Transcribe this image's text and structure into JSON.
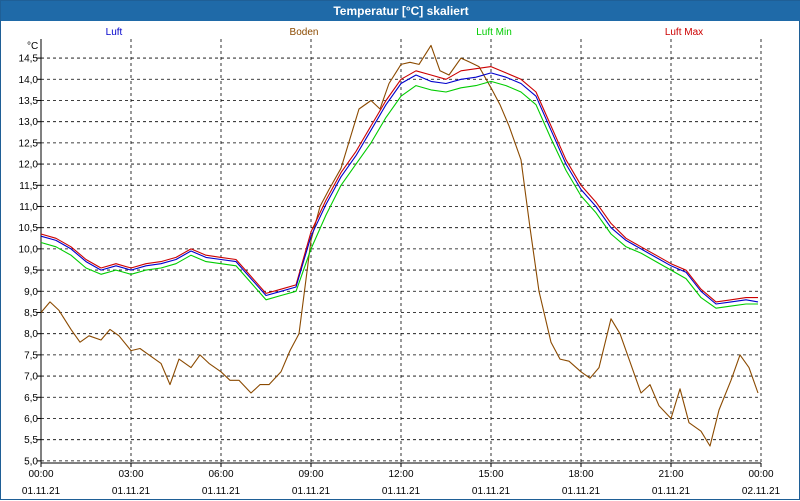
{
  "chart_data": {
    "type": "line",
    "title": "Temperatur [°C] skaliert",
    "ylabel": "°C",
    "xlabel": "",
    "ylim": [
      4.95,
      14.95
    ],
    "xlim": [
      0,
      24
    ],
    "grid": true,
    "legend_position": "top",
    "y_ticks": [
      "5,0",
      "5,5",
      "6,0",
      "6,5",
      "7,0",
      "7,5",
      "8,0",
      "8,5",
      "9,0",
      "9,5",
      "10,0",
      "10,5",
      "11,0",
      "11,5",
      "12,0",
      "12,5",
      "13,0",
      "13,5",
      "14,0",
      "14,5"
    ],
    "x_ticks": [
      {
        "time": "00:00",
        "date": "01.11.21"
      },
      {
        "time": "03:00",
        "date": "01.11.21"
      },
      {
        "time": "06:00",
        "date": "01.11.21"
      },
      {
        "time": "09:00",
        "date": "01.11.21"
      },
      {
        "time": "12:00",
        "date": "01.11.21"
      },
      {
        "time": "15:00",
        "date": "01.11.21"
      },
      {
        "time": "18:00",
        "date": "01.11.21"
      },
      {
        "time": "21:00",
        "date": "01.11.21"
      },
      {
        "time": "00:00",
        "date": "02.11.21"
      }
    ],
    "x_unit": "hours since 01.11.21 00:00",
    "series": [
      {
        "name": "Luft",
        "color": "#0000cc",
        "x": [
          0,
          0.5,
          1,
          1.5,
          2,
          2.5,
          3,
          3.5,
          4,
          4.5,
          5,
          5.5,
          6,
          6.5,
          7,
          7.5,
          8,
          8.5,
          9,
          9.5,
          10,
          10.5,
          11,
          11.5,
          12,
          12.5,
          13,
          13.5,
          14,
          14.5,
          15,
          15.5,
          16,
          16.5,
          17,
          17.5,
          18,
          18.5,
          19,
          19.5,
          20,
          20.5,
          21,
          21.5,
          22,
          22.5,
          23,
          23.5,
          23.9
        ],
        "values": [
          10.3,
          10.2,
          10,
          9.7,
          9.5,
          9.6,
          9.5,
          9.6,
          9.65,
          9.75,
          9.95,
          9.8,
          9.75,
          9.7,
          9.3,
          8.9,
          9,
          9.1,
          10.3,
          11.05,
          11.7,
          12.2,
          12.8,
          13.4,
          13.9,
          14.1,
          13.95,
          13.9,
          14.0,
          14.05,
          14.15,
          14.05,
          13.9,
          13.6,
          12.8,
          12.0,
          11.4,
          11.0,
          10.5,
          10.2,
          10.0,
          9.8,
          9.6,
          9.45,
          9.0,
          8.7,
          8.75,
          8.8,
          8.75
        ]
      },
      {
        "name": "Boden",
        "color": "#8b4a00",
        "x": [
          0,
          0.3,
          0.6,
          1,
          1.3,
          1.6,
          2,
          2.3,
          2.6,
          3,
          3.3,
          3.6,
          4,
          4.3,
          4.6,
          5,
          5.3,
          5.6,
          6,
          6.3,
          6.6,
          7,
          7.3,
          7.6,
          8,
          8.3,
          8.6,
          9,
          9.3,
          9.6,
          10,
          10.3,
          10.6,
          11,
          11.3,
          11.6,
          12,
          12.3,
          12.6,
          13,
          13.3,
          13.6,
          14,
          14.3,
          14.6,
          15,
          15.3,
          15.6,
          16,
          16.3,
          16.6,
          17,
          17.3,
          17.6,
          18,
          18.3,
          18.6,
          19,
          19.3,
          19.6,
          20,
          20.3,
          20.6,
          21,
          21.3,
          21.6,
          22,
          22.3,
          22.6,
          23,
          23.3,
          23.6,
          23.9
        ],
        "values": [
          8.5,
          8.75,
          8.55,
          8.1,
          7.8,
          7.95,
          7.85,
          8.1,
          7.95,
          7.6,
          7.65,
          7.5,
          7.3,
          6.8,
          7.4,
          7.2,
          7.5,
          7.3,
          7.1,
          6.9,
          6.9,
          6.6,
          6.8,
          6.8,
          7.1,
          7.6,
          8.0,
          10.2,
          11.0,
          11.4,
          11.9,
          12.6,
          13.3,
          13.5,
          13.3,
          13.9,
          14.35,
          14.4,
          14.35,
          14.8,
          14.2,
          14.1,
          14.5,
          14.4,
          14.3,
          13.8,
          13.4,
          12.9,
          12.1,
          10.5,
          9.0,
          7.8,
          7.4,
          7.35,
          7.1,
          6.95,
          7.2,
          8.35,
          8.0,
          7.4,
          6.6,
          6.8,
          6.3,
          6.0,
          6.7,
          5.9,
          5.7,
          5.35,
          6.2,
          6.9,
          7.5,
          7.2,
          6.6
        ]
      },
      {
        "name": "Luft Min",
        "color": "#00cc00",
        "x": [
          0,
          0.5,
          1,
          1.5,
          2,
          2.5,
          3,
          3.5,
          4,
          4.5,
          5,
          5.5,
          6,
          6.5,
          7,
          7.5,
          8,
          8.5,
          9,
          9.5,
          10,
          10.5,
          11,
          11.5,
          12,
          12.5,
          13,
          13.5,
          14,
          14.5,
          15,
          15.5,
          16,
          16.5,
          17,
          17.5,
          18,
          18.5,
          19,
          19.5,
          20,
          20.5,
          21,
          21.5,
          22,
          22.5,
          23,
          23.5,
          23.9
        ],
        "values": [
          10.15,
          10.05,
          9.85,
          9.55,
          9.4,
          9.5,
          9.4,
          9.5,
          9.55,
          9.65,
          9.85,
          9.7,
          9.65,
          9.6,
          9.2,
          8.8,
          8.9,
          9.0,
          10.0,
          10.8,
          11.5,
          12.0,
          12.5,
          13.1,
          13.6,
          13.85,
          13.75,
          13.7,
          13.8,
          13.85,
          13.95,
          13.85,
          13.7,
          13.4,
          12.6,
          11.85,
          11.25,
          10.85,
          10.35,
          10.05,
          9.9,
          9.7,
          9.5,
          9.3,
          8.85,
          8.6,
          8.65,
          8.7,
          8.7
        ]
      },
      {
        "name": "Luft Max",
        "color": "#cc0000",
        "x": [
          0,
          0.5,
          1,
          1.5,
          2,
          2.5,
          3,
          3.5,
          4,
          4.5,
          5,
          5.5,
          6,
          6.5,
          7,
          7.5,
          8,
          8.5,
          9,
          9.5,
          10,
          10.5,
          11,
          11.5,
          12,
          12.5,
          13,
          13.5,
          14,
          14.5,
          15,
          15.5,
          16,
          16.5,
          17,
          17.5,
          18,
          18.5,
          19,
          19.5,
          20,
          20.5,
          21,
          21.5,
          22,
          22.5,
          23,
          23.5,
          23.9
        ],
        "values": [
          10.35,
          10.25,
          10.05,
          9.75,
          9.55,
          9.65,
          9.55,
          9.65,
          9.7,
          9.8,
          10.0,
          9.85,
          9.8,
          9.75,
          9.35,
          8.95,
          9.05,
          9.15,
          10.4,
          11.15,
          11.8,
          12.3,
          12.9,
          13.5,
          14.0,
          14.2,
          14.1,
          14.0,
          14.2,
          14.25,
          14.3,
          14.15,
          14.0,
          13.7,
          12.9,
          12.1,
          11.5,
          11.1,
          10.6,
          10.25,
          10.05,
          9.85,
          9.65,
          9.5,
          9.05,
          8.75,
          8.8,
          8.85,
          8.85
        ]
      }
    ]
  }
}
